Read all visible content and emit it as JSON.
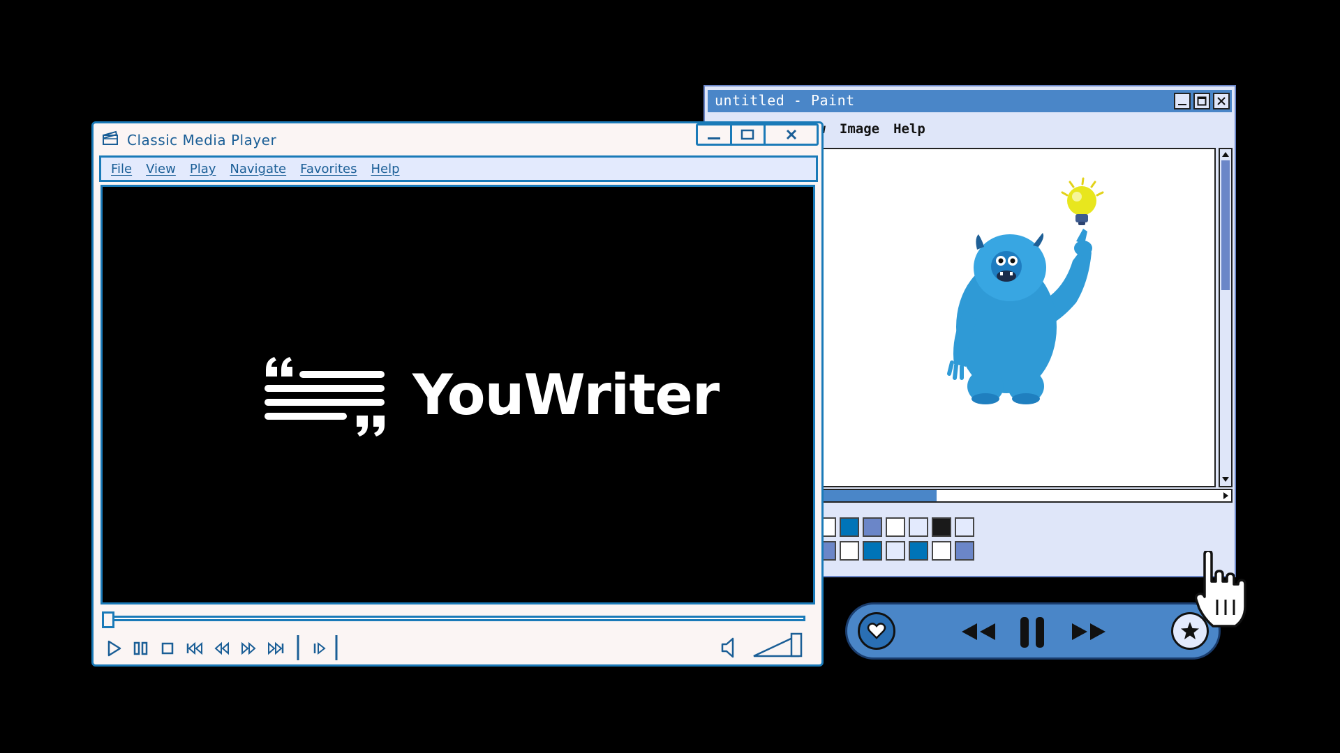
{
  "paint": {
    "title": "untitled - Paint",
    "menu": [
      "ew",
      "Image",
      "Help"
    ],
    "palette_top": [
      "#ffffff",
      "#0074b8",
      "#6b86c8",
      "#ffffff",
      "#e3eafd",
      "#1a1a1a",
      "#e3eafd"
    ],
    "palette_bottom": [
      "#6b86c8",
      "#ffffff",
      "#0074b8",
      "#e3eafd",
      "#0074b8",
      "#ffffff",
      "#6b86c8"
    ]
  },
  "media_player": {
    "title": "Classic Media Player",
    "menu": [
      "File",
      "View",
      "Play",
      "Navigate",
      "Favorites",
      "Help"
    ],
    "logo_text": "YouWriter",
    "progress": 0.0
  },
  "colors": {
    "accent_blue": "#1a7ab8",
    "paint_title_blue": "#4a86c8",
    "mini_player_blue": "#4a86c8"
  }
}
